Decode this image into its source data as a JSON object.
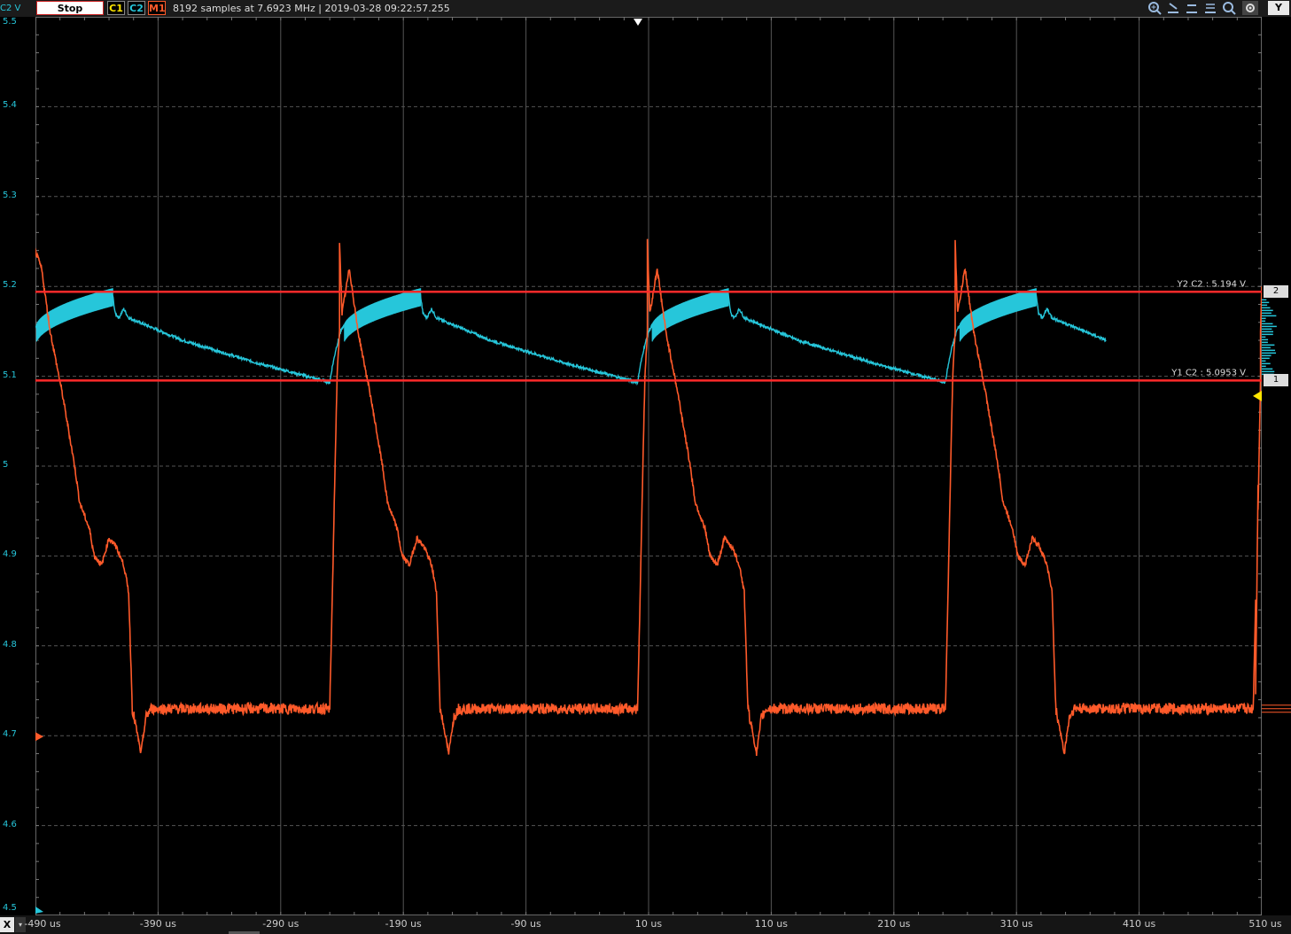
{
  "toolbar": {
    "channel_axis_label": "C2 V",
    "stop_label": "Stop",
    "channels": [
      {
        "label": "C1",
        "color": "#ffe600"
      },
      {
        "label": "C2",
        "color": "#26c6da"
      },
      {
        "label": "M1",
        "color": "#ff5a2a"
      }
    ],
    "acquisition_info": "8192 samples at 7.6923 MHz | 2019-03-28 09:22:57.255",
    "tools": [
      "zoom-in-icon",
      "cursor-x1-icon",
      "cursor-x2-icon",
      "cursor-x3-icon",
      "zoom-out-icon",
      "settings-icon"
    ],
    "y_button": "Y"
  },
  "bottom": {
    "x_button": "X",
    "x_dropdown": "▾"
  },
  "cursors": [
    {
      "label": "Y2 C2 : 5.194 V",
      "tag": "2",
      "value": 5.194,
      "color": "#ff2a2a"
    },
    {
      "label": "Y1 C2 : 5.0953 V",
      "tag": "1",
      "value": 5.0953,
      "color": "#ff2a2a"
    }
  ],
  "chart_data": {
    "type": "line",
    "xlim": [
      -490,
      510
    ],
    "ylim": [
      4.5,
      5.5
    ],
    "grid": true,
    "x_ticks": [
      {
        "v": -490,
        "label": "-490 us"
      },
      {
        "v": -390,
        "label": "-390 us"
      },
      {
        "v": -290,
        "label": "-290 us"
      },
      {
        "v": -190,
        "label": "-190 us"
      },
      {
        "v": -90,
        "label": "-90 us"
      },
      {
        "v": 10,
        "label": "10 us"
      },
      {
        "v": 110,
        "label": "110 us"
      },
      {
        "v": 210,
        "label": "210 us"
      },
      {
        "v": 310,
        "label": "310 us"
      },
      {
        "v": 410,
        "label": "410 us"
      },
      {
        "v": 510,
        "label": "510 us"
      }
    ],
    "y_ticks": [
      {
        "v": 5.5,
        "label": "5.5"
      },
      {
        "v": 5.4,
        "label": "5.4"
      },
      {
        "v": 5.3,
        "label": "5.3"
      },
      {
        "v": 5.2,
        "label": "5.2"
      },
      {
        "v": 5.1,
        "label": "5.1"
      },
      {
        "v": 5.0,
        "label": "5"
      },
      {
        "v": 4.9,
        "label": "4.9"
      },
      {
        "v": 4.8,
        "label": "4.8"
      },
      {
        "v": 4.7,
        "label": "4.7"
      },
      {
        "v": 4.6,
        "label": "4.6"
      },
      {
        "v": 4.5,
        "label": "4.5"
      }
    ],
    "series": [
      {
        "name": "C2",
        "color": "#26c6da",
        "period": 251,
        "periods_start": [
          -490,
          -239,
          12,
          263
        ],
        "shape": [
          [
            0,
            5.155
          ],
          [
            6,
            5.16
          ],
          [
            15,
            5.17
          ],
          [
            30,
            5.175
          ],
          [
            45,
            5.18
          ],
          [
            60,
            5.19
          ],
          [
            63,
            5.19
          ],
          [
            65,
            5.17
          ],
          [
            68,
            5.165
          ],
          [
            72,
            5.175
          ],
          [
            76,
            5.165
          ],
          [
            120,
            5.14
          ],
          [
            180,
            5.115
          ],
          [
            235,
            5.095
          ],
          [
            240,
            5.093
          ],
          [
            242,
            5.11
          ],
          [
            245,
            5.13
          ],
          [
            249,
            5.15
          ],
          [
            251,
            5.155
          ]
        ],
        "end_x": 438
      },
      {
        "name": "M1",
        "color": "#ff5a2a",
        "period": 251,
        "periods_start": [
          -490,
          -239,
          12,
          263
        ],
        "shape": [
          [
            -3,
            5.25
          ],
          [
            5,
            5.22
          ],
          [
            12,
            5.15
          ],
          [
            22,
            5.08
          ],
          [
            32,
            5.0
          ],
          [
            36,
            4.96
          ],
          [
            44,
            4.93
          ],
          [
            48,
            4.9
          ],
          [
            54,
            4.89
          ],
          [
            60,
            4.92
          ],
          [
            66,
            4.91
          ],
          [
            72,
            4.89
          ],
          [
            76,
            4.86
          ],
          [
            79,
            4.73
          ],
          [
            82,
            4.71
          ],
          [
            86,
            4.68
          ],
          [
            90,
            4.72
          ],
          [
            94,
            4.73
          ],
          [
            110,
            4.73
          ],
          [
            150,
            4.73
          ],
          [
            200,
            4.73
          ],
          [
            236,
            4.73
          ],
          [
            240,
            4.73
          ],
          [
            242,
            4.85
          ],
          [
            244,
            4.98
          ],
          [
            246,
            5.1
          ],
          [
            248,
            5.15
          ],
          [
            250,
            5.17
          ]
        ],
        "overlay_start": 0,
        "end_x": 510
      }
    ]
  }
}
